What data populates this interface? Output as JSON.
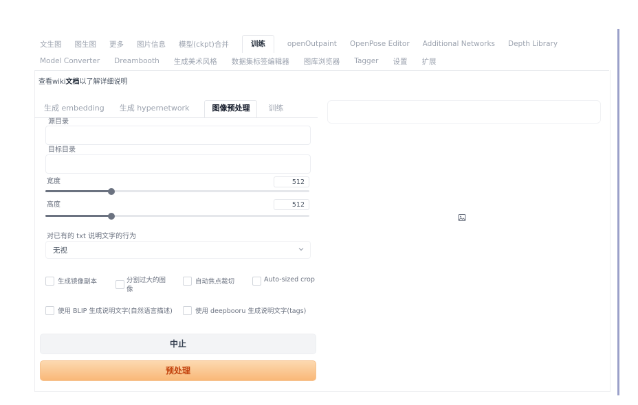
{
  "top_tabs_row1": [
    "文生图",
    "图生图",
    "更多",
    "图片信息",
    "模型(ckpt)合并",
    "训练",
    "openOutpaint",
    "OpenPose Editor",
    "Additional Networks",
    "Depth Library"
  ],
  "top_tabs_row2": [
    "Model Converter",
    "Dreambooth",
    "生成美术风格",
    "数据集标签编辑器",
    "图库浏览器",
    "Tagger",
    "设置",
    "扩展"
  ],
  "active_top_tab": "训练",
  "wiki_note": {
    "prefix": "查看wiki",
    "bold": "文档",
    "suffix": "以了解详细说明"
  },
  "sub_tabs": [
    "生成 embedding",
    "生成 hypernetwork",
    "图像预处理",
    "训练"
  ],
  "active_sub_tab": "图像预处理",
  "form": {
    "source_dir_label": "源目录",
    "source_dir_value": "",
    "dest_dir_label": "目标目录",
    "dest_dir_value": "",
    "width_label": "宽度",
    "width_value": "512",
    "height_label": "高度",
    "height_value": "512",
    "slider_fraction": 0.25,
    "caption_action_label": "对已有的 txt 说明文字的行为",
    "caption_action_value": "无视",
    "checkboxes_row1": [
      "生成镜像副本",
      "分割过大的图像",
      "自动焦点裁切",
      "Auto-sized crop"
    ],
    "checkboxes_row2": [
      "使用 BLIP 生成说明文字(自然语言描述)",
      "使用 deepbooru 生成说明文字(tags)"
    ],
    "stop_label": "中止",
    "run_label": "预处理"
  },
  "colors": {
    "accent_orange": "#f9b878",
    "right_bar": "#9aa0c9"
  },
  "icons": {
    "output_image": "image-icon",
    "dropdown": "chevron-down-icon"
  }
}
